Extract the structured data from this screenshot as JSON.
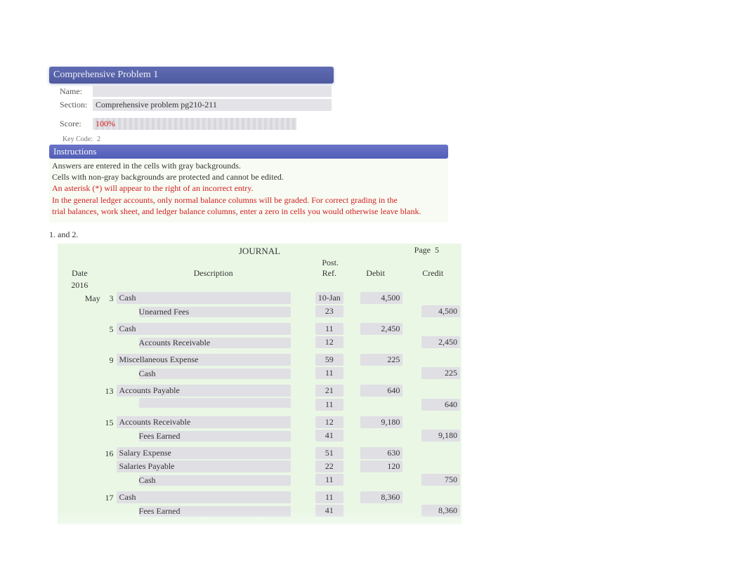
{
  "header": {
    "title": "Comprehensive Problem 1",
    "name_label": "Name:",
    "name_value": "",
    "section_label": "Section:",
    "section_value": "Comprehensive problem pg210-211",
    "score_label": "Score:",
    "score_value": "100%",
    "keycode_label": "Key Code:",
    "keycode_value": "2"
  },
  "instructions": {
    "bar": "Instructions",
    "line1": "Answers are entered in the cells with gray backgrounds.",
    "line2": "Cells with non-gray backgrounds are protected and cannot be edited.",
    "line3": "An asterisk (*) will appear to the right of an incorrect entry.",
    "line4": "In the general ledger accounts, only normal balance columns will be graded. For correct grading in the",
    "line5": "trial balances, work sheet, and ledger balance columns, enter a zero in cells you would otherwise leave blank."
  },
  "section_label": "1. and 2.",
  "journal": {
    "title": "JOURNAL",
    "page_label": "Page",
    "page_number": "5",
    "post_label": "Post.",
    "cols": {
      "date": "Date",
      "desc": "Description",
      "ref": "Ref.",
      "debit": "Debit",
      "credit": "Credit"
    },
    "year": "2016",
    "month": "May",
    "entries": [
      {
        "day": "3",
        "lines": [
          {
            "desc": "Cash",
            "indent": false,
            "ref": "10-Jan",
            "debit": "4,500",
            "credit": ""
          },
          {
            "desc": "Unearned Fees",
            "indent": true,
            "ref": "23",
            "debit": "",
            "credit": "4,500"
          }
        ]
      },
      {
        "day": "5",
        "lines": [
          {
            "desc": "Cash",
            "indent": false,
            "ref": "11",
            "debit": "2,450",
            "credit": ""
          },
          {
            "desc": "Accounts Receivable",
            "indent": true,
            "ref": "12",
            "debit": "",
            "credit": "2,450"
          }
        ]
      },
      {
        "day": "9",
        "lines": [
          {
            "desc": "Miscellaneous Expense",
            "indent": false,
            "ref": "59",
            "debit": "225",
            "credit": ""
          },
          {
            "desc": "Cash",
            "indent": true,
            "ref": "11",
            "debit": "",
            "credit": "225"
          }
        ]
      },
      {
        "day": "13",
        "lines": [
          {
            "desc": "Accounts Payable",
            "indent": false,
            "ref": "21",
            "debit": "640",
            "credit": ""
          },
          {
            "desc": "",
            "indent": true,
            "ref": "11",
            "debit": "",
            "credit": "640"
          }
        ]
      },
      {
        "day": "15",
        "lines": [
          {
            "desc": "Accounts Receivable",
            "indent": false,
            "ref": "12",
            "debit": "9,180",
            "credit": ""
          },
          {
            "desc": "Fees Earned",
            "indent": true,
            "ref": "41",
            "debit": "",
            "credit": "9,180"
          }
        ]
      },
      {
        "day": "16",
        "lines": [
          {
            "desc": "Salary Expense",
            "indent": false,
            "ref": "51",
            "debit": "630",
            "credit": ""
          },
          {
            "desc": "Salaries Payable",
            "indent": false,
            "ref": "22",
            "debit": "120",
            "credit": ""
          },
          {
            "desc": "Cash",
            "indent": true,
            "ref": "11",
            "debit": "",
            "credit": "750"
          }
        ]
      },
      {
        "day": "17",
        "lines": [
          {
            "desc": "Cash",
            "indent": false,
            "ref": "11",
            "debit": "8,360",
            "credit": ""
          },
          {
            "desc": "Fees Earned",
            "indent": true,
            "ref": "41",
            "debit": "",
            "credit": "8,360"
          }
        ]
      }
    ]
  }
}
